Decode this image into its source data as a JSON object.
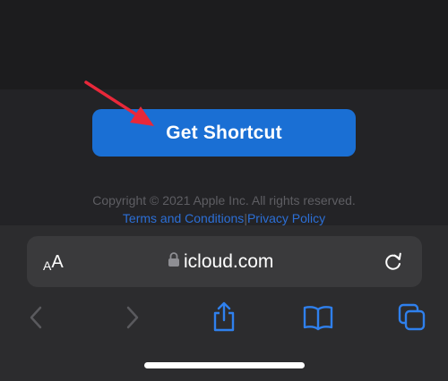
{
  "page": {
    "cta_label": "Get Shortcut",
    "copyright": "Copyright © 2021 Apple Inc. All rights reserved.",
    "terms_link": "Terms and Conditions",
    "separator": "|",
    "privacy_link": "Privacy Policy"
  },
  "address_bar": {
    "text_size_small": "A",
    "text_size_big": "A",
    "url": "icloud.com"
  },
  "toolbar": {
    "icons": [
      "back-icon",
      "forward-icon",
      "share-icon",
      "bookmarks-icon",
      "tabs-icon"
    ]
  },
  "colors": {
    "accent": "#1a6fd4",
    "link": "#2c6fd6",
    "annotation_arrow": "#e8283a"
  }
}
